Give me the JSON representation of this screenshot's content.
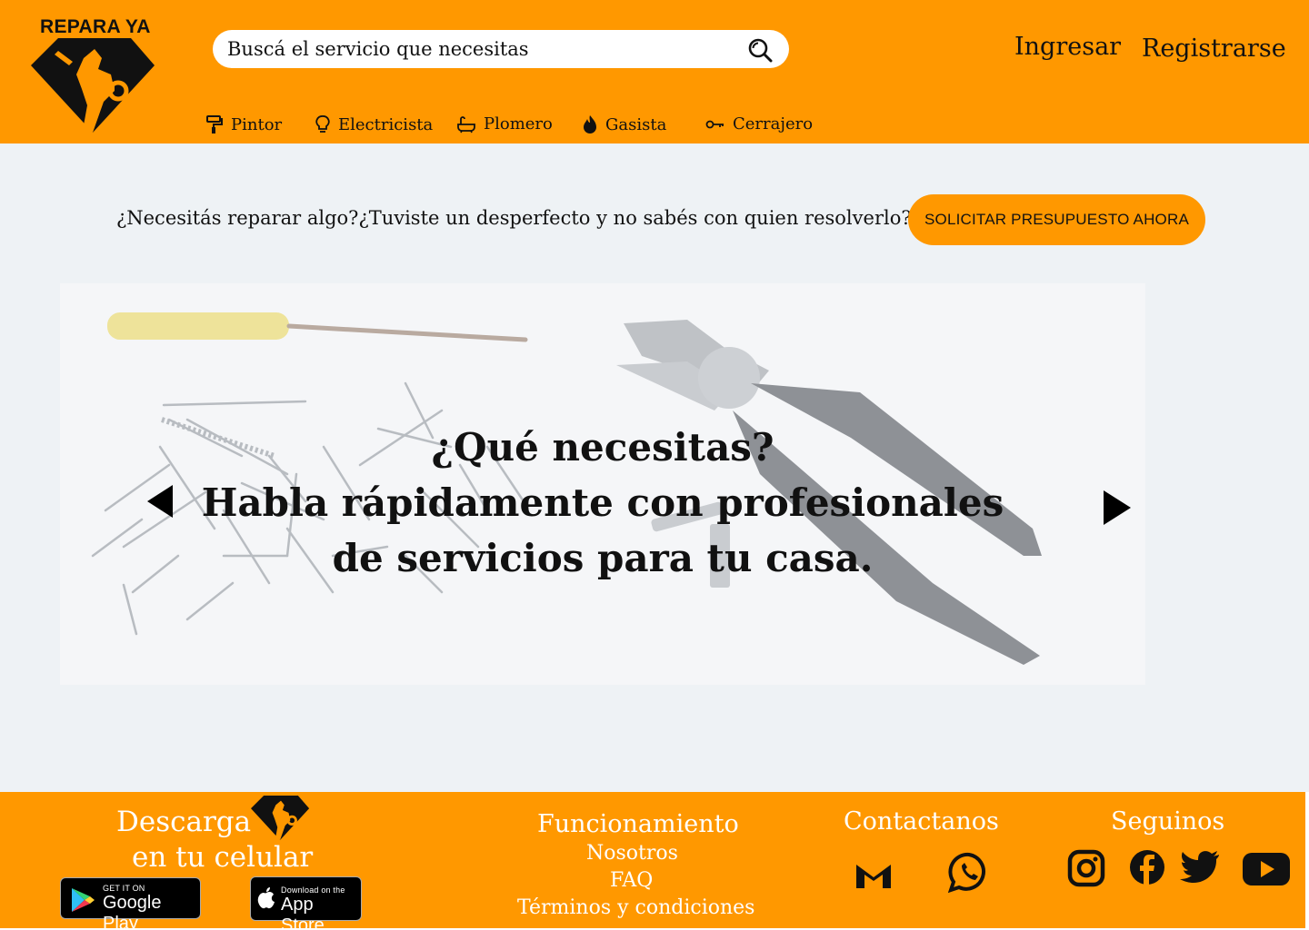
{
  "brand": {
    "name": "REPARA YA"
  },
  "search": {
    "placeholder": "Buscá el servicio que necesitas"
  },
  "auth": {
    "login": "Ingresar",
    "register": "Registrarse"
  },
  "categories": [
    {
      "label": "Pintor",
      "icon": "paint-roller-icon"
    },
    {
      "label": "Electricista",
      "icon": "lightbulb-icon"
    },
    {
      "label": "Plomero",
      "icon": "bathtub-icon"
    },
    {
      "label": "Gasista",
      "icon": "flame-icon"
    },
    {
      "label": "Cerrajero",
      "icon": "key-icon"
    }
  ],
  "cta": {
    "text": "¿Necesitás reparar algo?¿Tuviste un desperfecto y no sabés con quien resolverlo?",
    "button": "SOLICITAR PRESUPUESTO AHORA"
  },
  "hero": {
    "line1": "¿Qué necesitas?",
    "line2": "Habla rápidamente con profesionales",
    "line3": "de servicios para tu casa."
  },
  "footer": {
    "download_line1": "Descarga",
    "download_line2": "en tu celular",
    "google_play": {
      "small": "GET IT ON",
      "big": "Google Play"
    },
    "app_store": {
      "small": "Download on the",
      "big": "App Store"
    },
    "info_title": "Funcionamiento",
    "links": [
      "Nosotros",
      "FAQ",
      "Términos y condiciones"
    ],
    "contact_title": "Contactanos",
    "social_title": "Seguinos"
  },
  "colors": {
    "accent": "#ff9800",
    "background": "#eef2f5",
    "text": "#111111",
    "footer_text": "#ffffff"
  }
}
